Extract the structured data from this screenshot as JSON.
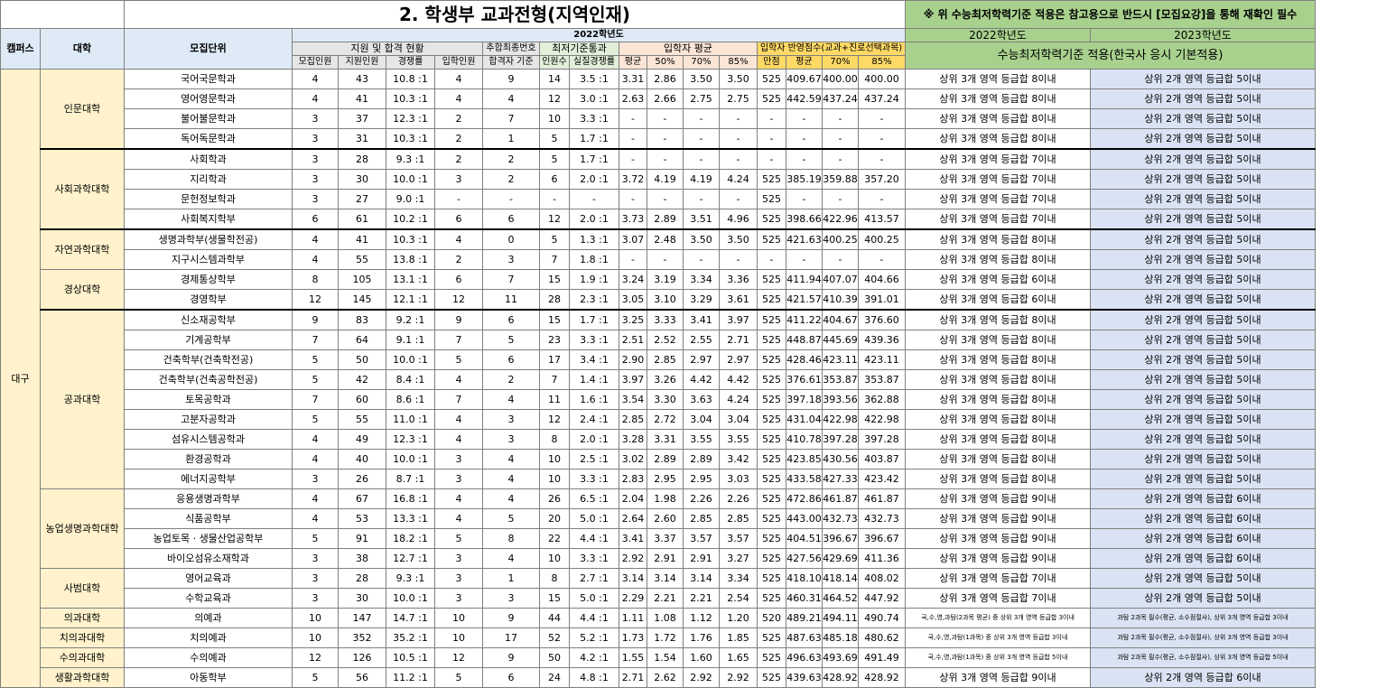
{
  "title": "2. 학생부 교과전형(지역인재)",
  "note": "※ 위 수능최저학력기준 적용은 참고용으로 반드시 [모집요강]을 통해 재확인 필수",
  "headers": {
    "campus": "캠퍼스",
    "college": "대학",
    "dept": "모집단위",
    "year2022": "2022학년도",
    "applyGroup": "지원 및 합격 현황",
    "extraGroup": "추합최종번호",
    "minGroup": "최저기준통과",
    "avgGroup": "입학자 평균",
    "scoreGroup": "입학자 반영점수(교과+진로선택과목)",
    "sub": [
      "모집인원",
      "지원인원",
      "경쟁률",
      "입학인원",
      "합격자 기준",
      "인원수",
      "실질경쟁률",
      "평균",
      "50%",
      "70%",
      "85%",
      "만점",
      "평균",
      "70%",
      "85%"
    ],
    "csat2022": "2022학년도",
    "csat2023": "2023학년도",
    "csatTitle": "수능최저학력기준 적용(한국사 응시 기본적용)"
  },
  "campus_name": "대구",
  "rows": [
    [
      "인문대학",
      4,
      "국어국문학과",
      "4",
      "43",
      "10.8 :1",
      "4",
      "9",
      "14",
      "3.5 :1",
      "3.31",
      "2.86",
      "3.50",
      "3.50",
      "525",
      "409.67",
      "400.00",
      "400.00",
      "상위 3개 영역 등급합 8이내",
      "상위 2개 영역 등급합 5이내"
    ],
    [
      "",
      "",
      "영어영문학과",
      "4",
      "41",
      "10.3 :1",
      "4",
      "4",
      "12",
      "3.0 :1",
      "2.63",
      "2.66",
      "2.75",
      "2.75",
      "525",
      "442.59",
      "437.24",
      "437.24",
      "상위 3개 영역 등급합 8이내",
      "상위 2개 영역 등급합 5이내"
    ],
    [
      "",
      "",
      "불어불문학과",
      "3",
      "37",
      "12.3 :1",
      "2",
      "7",
      "10",
      "3.3 :1",
      "-",
      "-",
      "-",
      "-",
      "-",
      "-",
      "-",
      "-",
      "상위 3개 영역 등급합 8이내",
      "상위 2개 영역 등급합 5이내"
    ],
    [
      "",
      "",
      "독어독문학과",
      "3",
      "31",
      "10.3 :1",
      "2",
      "1",
      "5",
      "1.7 :1",
      "-",
      "-",
      "-",
      "-",
      "-",
      "-",
      "-",
      "-",
      "상위 3개 영역 등급합 8이내",
      "상위 2개 영역 등급합 5이내"
    ],
    [
      "사회과학대학",
      4,
      "사회학과",
      "3",
      "28",
      "9.3 :1",
      "2",
      "2",
      "5",
      "1.7 :1",
      "-",
      "-",
      "-",
      "-",
      "-",
      "-",
      "-",
      "-",
      "상위 3개 영역 등급합 7이내",
      "상위 2개 영역 등급합 5이내"
    ],
    [
      "",
      "",
      "지리학과",
      "3",
      "30",
      "10.0 :1",
      "3",
      "2",
      "6",
      "2.0 :1",
      "3.72",
      "4.19",
      "4.19",
      "4.24",
      "525",
      "385.19",
      "359.88",
      "357.20",
      "상위 3개 영역 등급합 7이내",
      "상위 2개 영역 등급합 5이내"
    ],
    [
      "",
      "",
      "문헌정보학과",
      "3",
      "27",
      "9.0 :1",
      "-",
      "-",
      "-",
      "-",
      "-",
      "-",
      "-",
      "-",
      "525",
      "-",
      "-",
      "-",
      "상위 3개 영역 등급합 7이내",
      "상위 2개 영역 등급합 5이내"
    ],
    [
      "",
      "",
      "사회복지학부",
      "6",
      "61",
      "10.2 :1",
      "6",
      "6",
      "12",
      "2.0 :1",
      "3.73",
      "2.89",
      "3.51",
      "4.96",
      "525",
      "398.66",
      "422.96",
      "413.57",
      "상위 3개 영역 등급합 7이내",
      "상위 2개 영역 등급합 5이내"
    ],
    [
      "자연과학대학",
      2,
      "생명과학부(생물학전공)",
      "4",
      "41",
      "10.3 :1",
      "4",
      "0",
      "5",
      "1.3 :1",
      "3.07",
      "2.48",
      "3.50",
      "3.50",
      "525",
      "421.63",
      "400.25",
      "400.25",
      "상위 3개 영역 등급합 8이내",
      "상위 2개 영역 등급합 5이내"
    ],
    [
      "",
      "",
      "지구시스템과학부",
      "4",
      "55",
      "13.8 :1",
      "2",
      "3",
      "7",
      "1.8 :1",
      "-",
      "-",
      "-",
      "-",
      "-",
      "-",
      "-",
      "-",
      "상위 3개 영역 등급합 8이내",
      "상위 2개 영역 등급합 5이내"
    ],
    [
      "경상대학",
      2,
      "경제통상학부",
      "8",
      "105",
      "13.1 :1",
      "6",
      "7",
      "15",
      "1.9 :1",
      "3.24",
      "3.19",
      "3.34",
      "3.36",
      "525",
      "411.94",
      "407.07",
      "404.66",
      "상위 3개 영역 등급합 6이내",
      "상위 2개 영역 등급합 5이내"
    ],
    [
      "",
      "",
      "경영학부",
      "12",
      "145",
      "12.1 :1",
      "12",
      "11",
      "28",
      "2.3 :1",
      "3.05",
      "3.10",
      "3.29",
      "3.61",
      "525",
      "421.57",
      "410.39",
      "391.01",
      "상위 3개 영역 등급합 6이내",
      "상위 2개 영역 등급합 5이내"
    ],
    [
      "공과대학",
      9,
      "신소재공학부",
      "9",
      "83",
      "9.2 :1",
      "9",
      "6",
      "15",
      "1.7 :1",
      "3.25",
      "3.33",
      "3.41",
      "3.97",
      "525",
      "411.22",
      "404.67",
      "376.60",
      "상위 3개 영역 등급합 8이내",
      "상위 2개 영역 등급합 5이내"
    ],
    [
      "",
      "",
      "기계공학부",
      "7",
      "64",
      "9.1 :1",
      "7",
      "5",
      "23",
      "3.3 :1",
      "2.51",
      "2.52",
      "2.55",
      "2.71",
      "525",
      "448.87",
      "445.69",
      "439.36",
      "상위 3개 영역 등급합 8이내",
      "상위 2개 영역 등급합 5이내"
    ],
    [
      "",
      "",
      "건축학부(건축학전공)",
      "5",
      "50",
      "10.0 :1",
      "5",
      "6",
      "17",
      "3.4 :1",
      "2.90",
      "2.85",
      "2.97",
      "2.97",
      "525",
      "428.46",
      "423.11",
      "423.11",
      "상위 3개 영역 등급합 8이내",
      "상위 2개 영역 등급합 5이내"
    ],
    [
      "",
      "",
      "건축학부(건축공학전공)",
      "5",
      "42",
      "8.4 :1",
      "4",
      "2",
      "7",
      "1.4 :1",
      "3.97",
      "3.26",
      "4.42",
      "4.42",
      "525",
      "376.61",
      "353.87",
      "353.87",
      "상위 3개 영역 등급합 8이내",
      "상위 2개 영역 등급합 5이내"
    ],
    [
      "",
      "",
      "토목공학과",
      "7",
      "60",
      "8.6 :1",
      "7",
      "4",
      "11",
      "1.6 :1",
      "3.54",
      "3.30",
      "3.63",
      "4.24",
      "525",
      "397.18",
      "393.56",
      "362.88",
      "상위 3개 영역 등급합 8이내",
      "상위 2개 영역 등급합 5이내"
    ],
    [
      "",
      "",
      "고분자공학과",
      "5",
      "55",
      "11.0 :1",
      "4",
      "3",
      "12",
      "2.4 :1",
      "2.85",
      "2.72",
      "3.04",
      "3.04",
      "525",
      "431.04",
      "422.98",
      "422.98",
      "상위 3개 영역 등급합 8이내",
      "상위 2개 영역 등급합 5이내"
    ],
    [
      "",
      "",
      "섬유시스템공학과",
      "4",
      "49",
      "12.3 :1",
      "4",
      "3",
      "8",
      "2.0 :1",
      "3.28",
      "3.31",
      "3.55",
      "3.55",
      "525",
      "410.78",
      "397.28",
      "397.28",
      "상위 3개 영역 등급합 8이내",
      "상위 2개 영역 등급합 5이내"
    ],
    [
      "",
      "",
      "환경공학과",
      "4",
      "40",
      "10.0 :1",
      "3",
      "4",
      "10",
      "2.5 :1",
      "3.02",
      "2.89",
      "2.89",
      "3.42",
      "525",
      "423.85",
      "430.56",
      "403.87",
      "상위 3개 영역 등급합 8이내",
      "상위 2개 영역 등급합 5이내"
    ],
    [
      "",
      "",
      "에너지공학부",
      "3",
      "26",
      "8.7 :1",
      "3",
      "4",
      "10",
      "3.3 :1",
      "2.83",
      "2.95",
      "2.95",
      "3.03",
      "525",
      "433.58",
      "427.33",
      "423.42",
      "상위 3개 영역 등급합 8이내",
      "상위 2개 영역 등급합 5이내"
    ],
    [
      "농업생명과학대학",
      4,
      "응용생명과학부",
      "4",
      "67",
      "16.8 :1",
      "4",
      "4",
      "26",
      "6.5 :1",
      "2.04",
      "1.98",
      "2.26",
      "2.26",
      "525",
      "472.86",
      "461.87",
      "461.87",
      "상위 3개 영역 등급합 9이내",
      "상위 2개 영역 등급합 6이내"
    ],
    [
      "",
      "",
      "식품공학부",
      "4",
      "53",
      "13.3 :1",
      "4",
      "5",
      "20",
      "5.0 :1",
      "2.64",
      "2.60",
      "2.85",
      "2.85",
      "525",
      "443.00",
      "432.73",
      "432.73",
      "상위 3개 영역 등급합 9이내",
      "상위 2개 영역 등급합 6이내"
    ],
    [
      "",
      "",
      "농업토목 · 생물산업공학부",
      "5",
      "91",
      "18.2 :1",
      "5",
      "8",
      "22",
      "4.4 :1",
      "3.41",
      "3.37",
      "3.57",
      "3.57",
      "525",
      "404.51",
      "396.67",
      "396.67",
      "상위 3개 영역 등급합 9이내",
      "상위 2개 영역 등급합 6이내"
    ],
    [
      "",
      "",
      "바이오섬유소재학과",
      "3",
      "38",
      "12.7 :1",
      "3",
      "4",
      "10",
      "3.3 :1",
      "2.92",
      "2.91",
      "2.91",
      "3.27",
      "525",
      "427.56",
      "429.69",
      "411.36",
      "상위 3개 영역 등급합 9이내",
      "상위 2개 영역 등급합 6이내"
    ],
    [
      "사범대학",
      2,
      "영어교육과",
      "3",
      "28",
      "9.3 :1",
      "3",
      "1",
      "8",
      "2.7 :1",
      "3.14",
      "3.14",
      "3.14",
      "3.34",
      "525",
      "418.10",
      "418.14",
      "408.02",
      "상위 3개 영역 등급합 7이내",
      "상위 2개 영역 등급합 5이내"
    ],
    [
      "",
      "",
      "수학교육과",
      "3",
      "30",
      "10.0 :1",
      "3",
      "3",
      "15",
      "5.0 :1",
      "2.29",
      "2.21",
      "2.21",
      "2.54",
      "525",
      "460.31",
      "464.52",
      "447.92",
      "상위 3개 영역 등급합 7이내",
      "상위 2개 영역 등급합 5이내"
    ],
    [
      "의과대학",
      1,
      "의예과",
      "10",
      "147",
      "14.7 :1",
      "10",
      "9",
      "44",
      "4.4 :1",
      "1.11",
      "1.08",
      "1.12",
      "1.20",
      "520",
      "489.21",
      "494.11",
      "490.74",
      "국,수,영,과탐(2과목 평균) 중 상위 3개 영역 등급합 3이내",
      "과탐 2과목 필수(평균, 소수점절사), 상위 3개 영역 등급합 3이내"
    ],
    [
      "치의과대학",
      1,
      "치의예과",
      "10",
      "352",
      "35.2 :1",
      "10",
      "17",
      "52",
      "5.2 :1",
      "1.73",
      "1.72",
      "1.76",
      "1.85",
      "525",
      "487.63",
      "485.18",
      "480.62",
      "국,수,영,과탐(1과목) 중 상위 3개 영역 등급합 3이내",
      "과탐 2과목 필수(평균, 소수점절사), 상위 3개 영역 등급합 3이내"
    ],
    [
      "수의과대학",
      1,
      "수의예과",
      "12",
      "126",
      "10.5 :1",
      "12",
      "9",
      "50",
      "4.2 :1",
      "1.55",
      "1.54",
      "1.60",
      "1.65",
      "525",
      "496.63",
      "493.69",
      "491.49",
      "국,수,영,과탐(1과목) 중 상위 3개 영역 등급합 5이내",
      "과탐 2과목 필수(평균, 소수점절사), 상위 3개 영역 등급합 5이내"
    ],
    [
      "생활과학대학",
      1,
      "아동학부",
      "5",
      "56",
      "11.2 :1",
      "5",
      "6",
      "24",
      "4.8 :1",
      "2.71",
      "2.62",
      "2.92",
      "2.92",
      "525",
      "439.63",
      "428.92",
      "428.92",
      "상위 3개 영역 등급합 9이내",
      "상위 2개 영역 등급합 6이내"
    ]
  ]
}
